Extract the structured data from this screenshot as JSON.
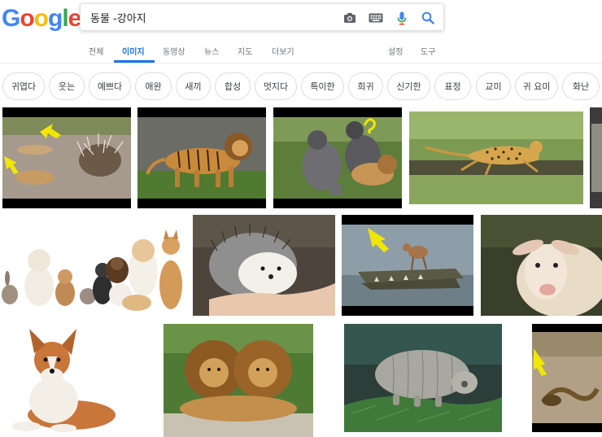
{
  "logo": {
    "letters": [
      "G",
      "o",
      "o",
      "g",
      "l",
      "e"
    ]
  },
  "search": {
    "query": "동물 -강아지"
  },
  "icons": {
    "camera": "camera-icon",
    "keyboard": "keyboard-icon",
    "mic": "microphone-icon",
    "search": "search-icon"
  },
  "tabs": [
    {
      "label": "전체"
    },
    {
      "label": "이미지"
    },
    {
      "label": "동영상"
    },
    {
      "label": "뉴스"
    },
    {
      "label": "지도"
    },
    {
      "label": "더보기"
    },
    {
      "label": "설정"
    },
    {
      "label": "도구"
    }
  ],
  "chips": [
    {
      "label": "귀엽다"
    },
    {
      "label": "웃는"
    },
    {
      "label": "예쁘다"
    },
    {
      "label": "애완"
    },
    {
      "label": "새끼"
    },
    {
      "label": "합성"
    },
    {
      "label": "멋지다"
    },
    {
      "label": "특이한"
    },
    {
      "label": "희귀"
    },
    {
      "label": "신기한"
    },
    {
      "label": "표정"
    },
    {
      "label": "교미"
    },
    {
      "label": "귀 요미"
    },
    {
      "label": "화난"
    }
  ],
  "colors": {
    "accent": "#1a73e8",
    "logo": [
      "#4285F4",
      "#EA4335",
      "#FBBC05",
      "#4285F4",
      "#34A853",
      "#EA4335"
    ]
  }
}
